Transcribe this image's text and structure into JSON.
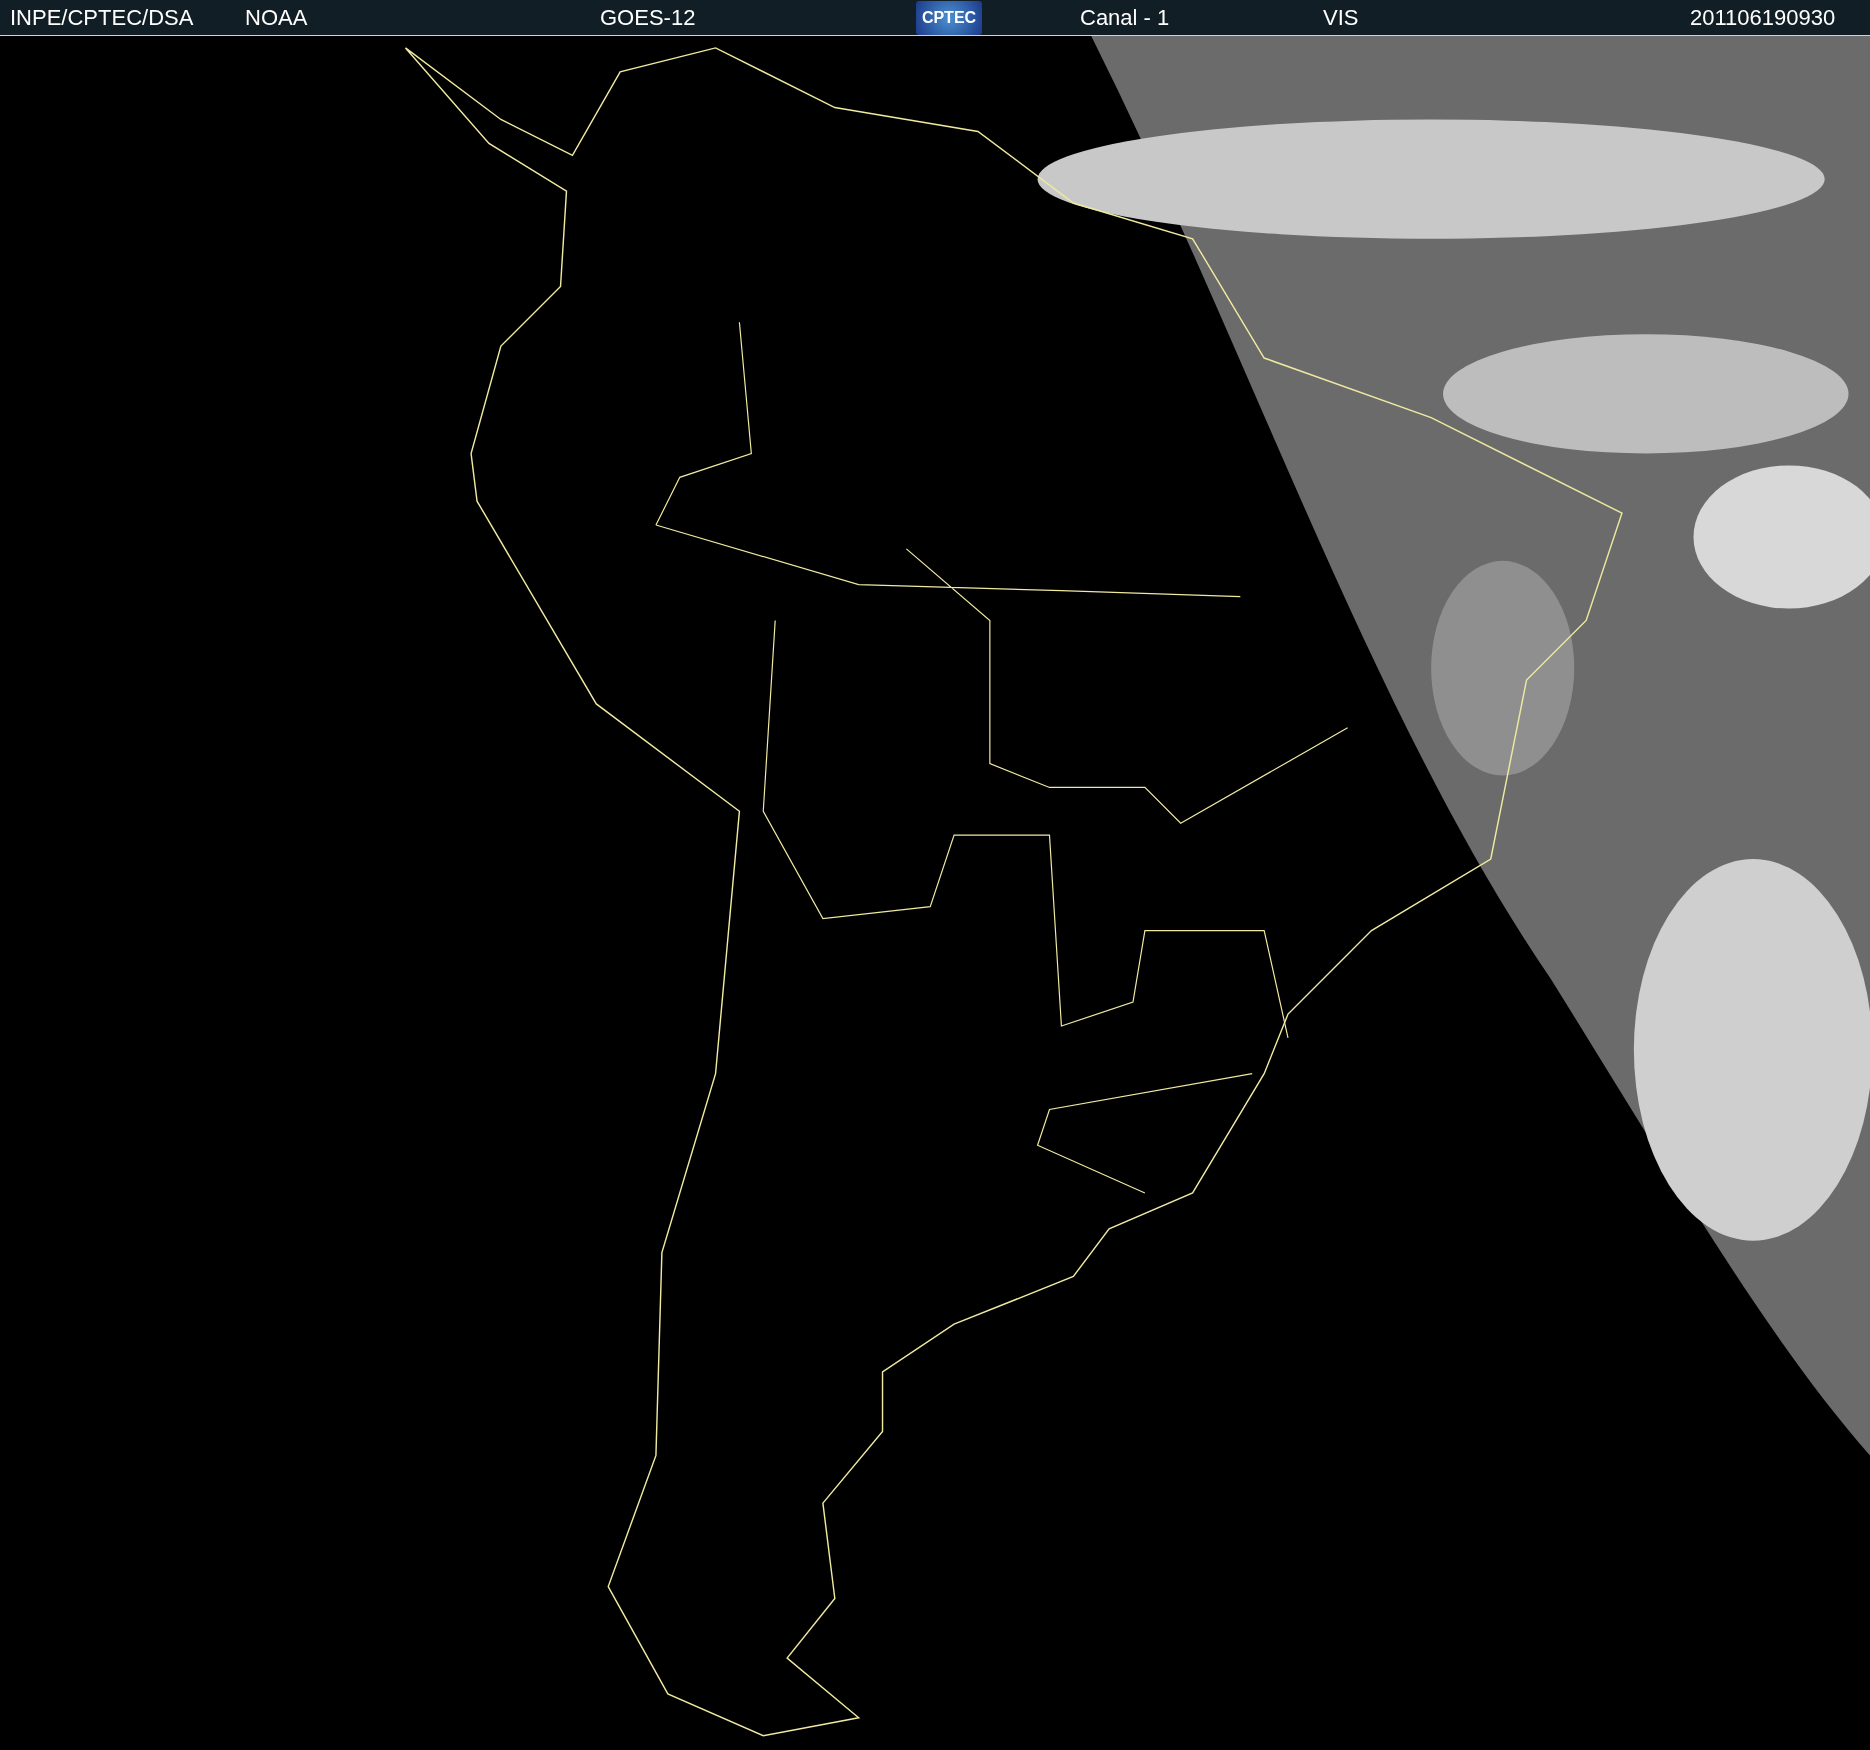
{
  "header": {
    "source": "INPE/CPTEC/DSA",
    "agency": "NOAA",
    "satellite": "GOES-12",
    "logo_text": "CPTEC",
    "channel": "Canal - 1",
    "band": "VIS",
    "timestamp": "201106190930"
  }
}
